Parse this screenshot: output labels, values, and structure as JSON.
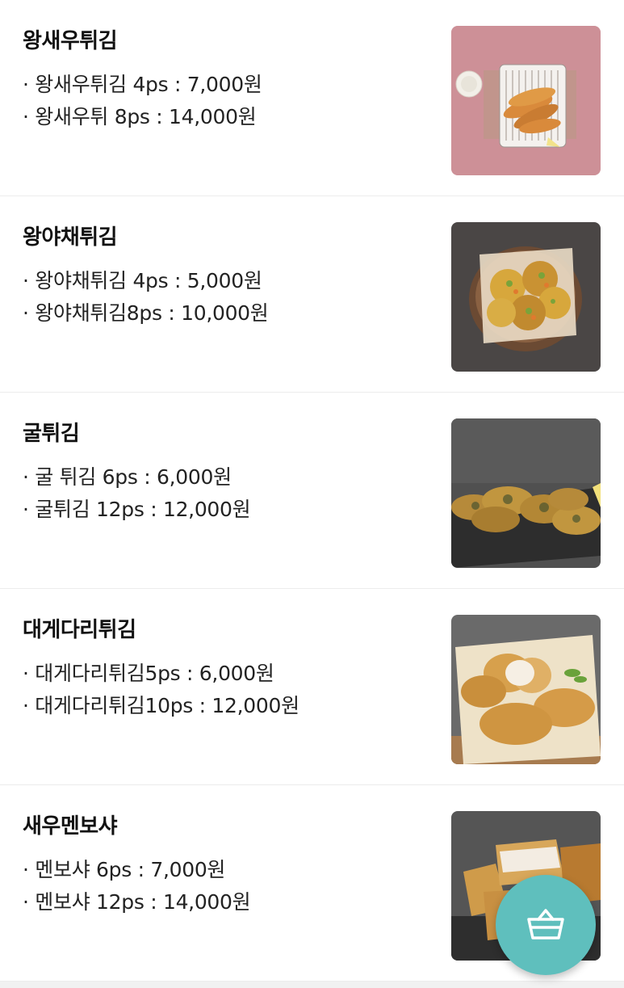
{
  "menu": {
    "items": [
      {
        "title": "왕새우튀김",
        "options": [
          "· 왕새우튀김 4ps : 7,000원",
          "· 왕새우튀  8ps : 14,000원"
        ],
        "photo_icon": "fried-shrimp-photo"
      },
      {
        "title": "왕야채튀김",
        "options": [
          "· 왕야채튀김 4ps : 5,000원",
          "· 왕야채튀김8ps : 10,000원"
        ],
        "photo_icon": "vegetable-fritter-photo"
      },
      {
        "title": "굴튀김",
        "options": [
          "· 굴 튀김 6ps : 6,000원",
          "· 굴튀김 12ps : 12,000원"
        ],
        "photo_icon": "fried-oyster-photo"
      },
      {
        "title": "대게다리튀김",
        "options": [
          "· 대게다리튀김5ps : 6,000원",
          "· 대게다리튀김10ps : 12,000원"
        ],
        "photo_icon": "crab-leg-fry-photo"
      },
      {
        "title": "새우멘보샤",
        "options": [
          "· 멘보샤 6ps : 7,000원",
          "· 멘보샤 12ps : 14,000원"
        ],
        "photo_icon": "shrimp-toast-photo"
      }
    ]
  },
  "cart_button": {
    "icon": "shopping-basket-icon",
    "color": "#5fbfbd"
  }
}
